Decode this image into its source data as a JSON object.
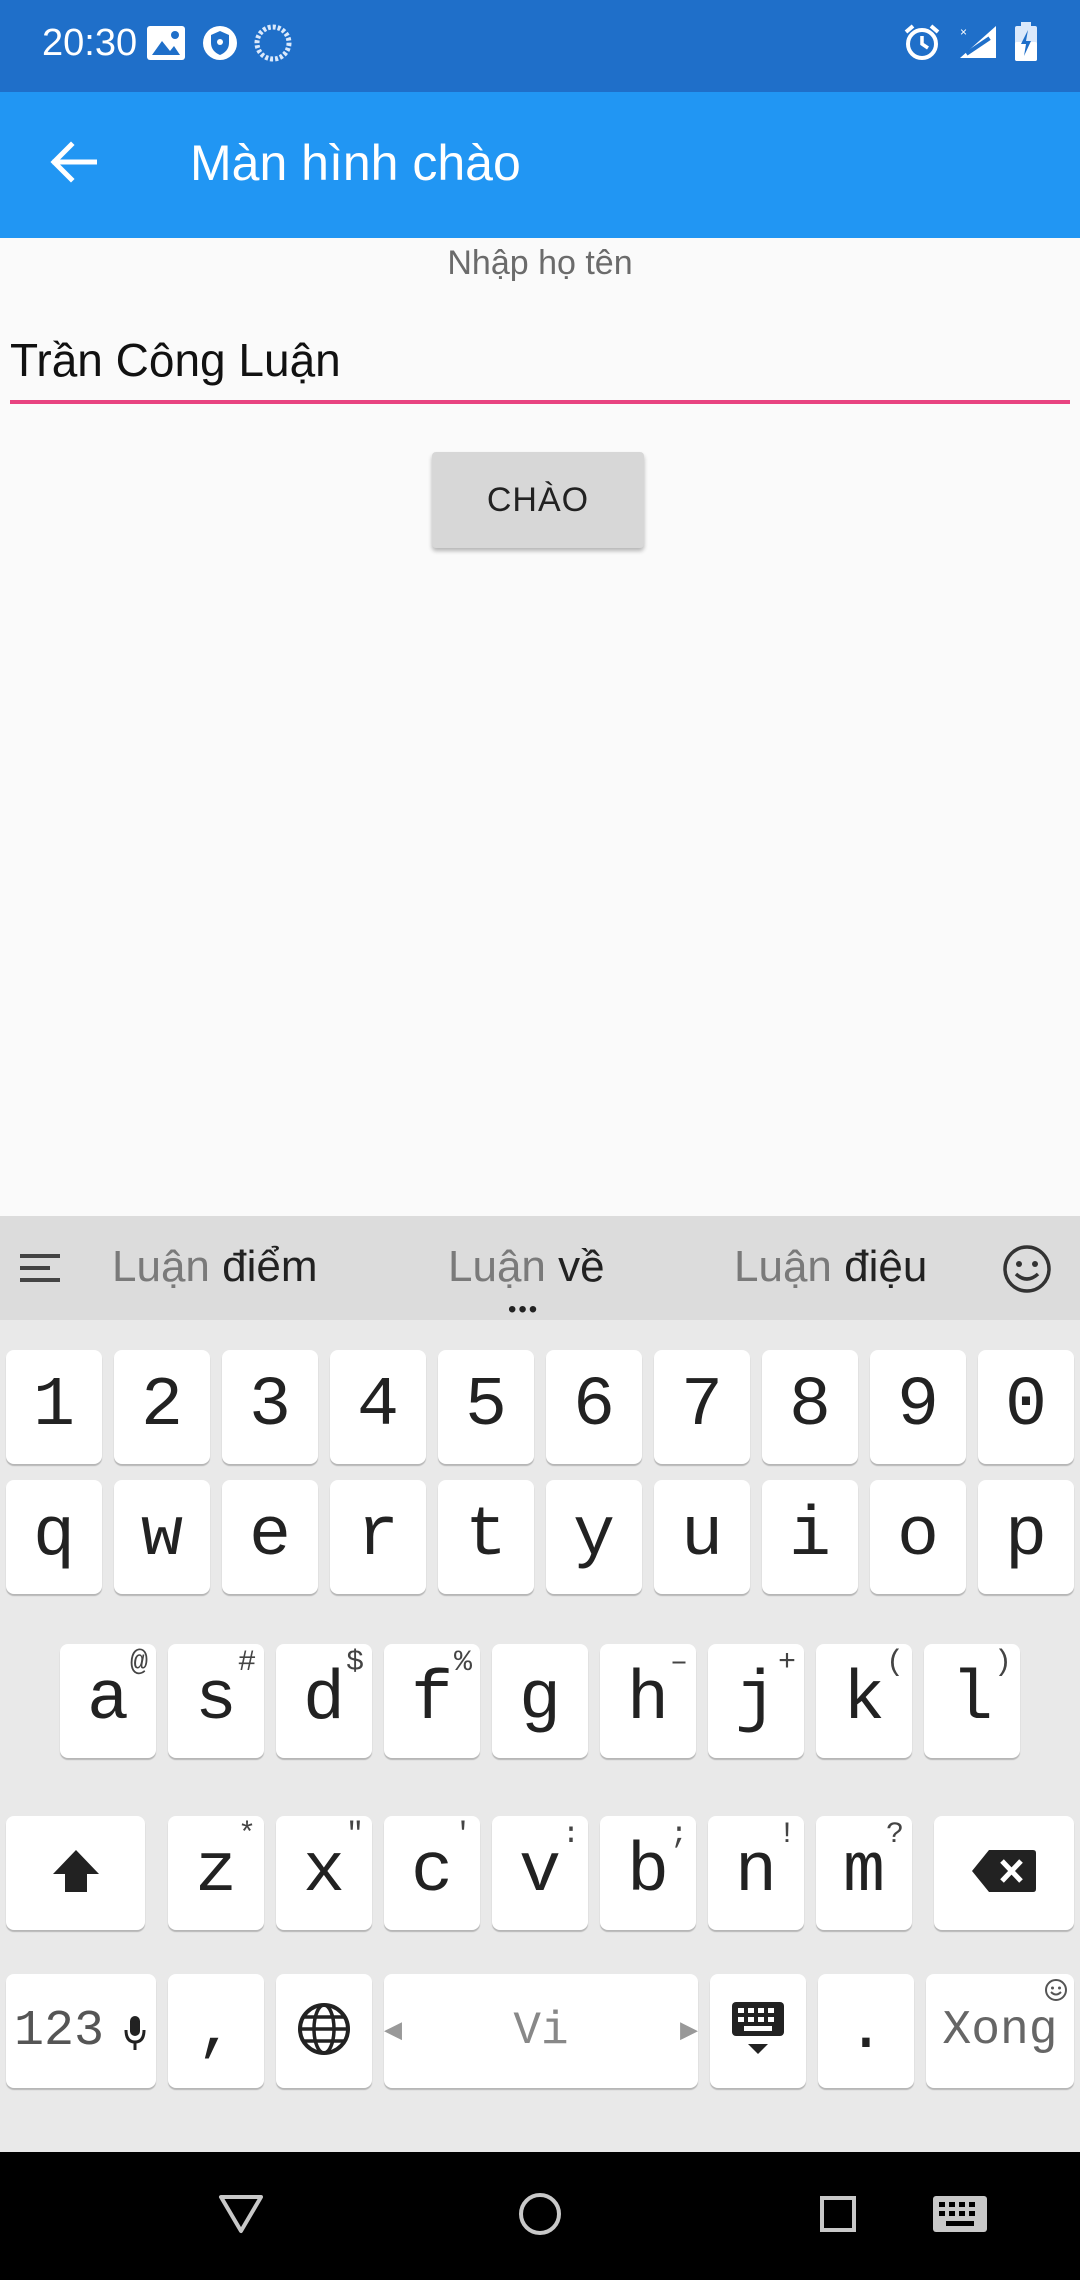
{
  "status_bar": {
    "time": "20:30"
  },
  "app_bar": {
    "title": "Màn hình chào"
  },
  "form": {
    "label": "Nhập họ tên",
    "name_value": "Trần Công Luận",
    "button_label": "CHÀO"
  },
  "keyboard": {
    "suggestions": [
      {
        "prefix": "Luận",
        "word": "điểm"
      },
      {
        "prefix": "Luận",
        "word": "về"
      },
      {
        "prefix": "Luận",
        "word": "điệu"
      }
    ],
    "row_numbers": [
      "1",
      "2",
      "3",
      "4",
      "5",
      "6",
      "7",
      "8",
      "9",
      "0"
    ],
    "row_qwerty": [
      "q",
      "w",
      "e",
      "r",
      "t",
      "y",
      "u",
      "i",
      "o",
      "p"
    ],
    "row_asdf": [
      {
        "key": "a",
        "hint": "@"
      },
      {
        "key": "s",
        "hint": "#"
      },
      {
        "key": "d",
        "hint": "$"
      },
      {
        "key": "f",
        "hint": "%"
      },
      {
        "key": "g",
        "hint": ""
      },
      {
        "key": "h",
        "hint": "–"
      },
      {
        "key": "j",
        "hint": "+"
      },
      {
        "key": "k",
        "hint": "("
      },
      {
        "key": "l",
        "hint": ")"
      }
    ],
    "row_zxcv": [
      {
        "key": "z",
        "hint": "*"
      },
      {
        "key": "x",
        "hint": "\""
      },
      {
        "key": "c",
        "hint": "'"
      },
      {
        "key": "v",
        "hint": ":"
      },
      {
        "key": "b",
        "hint": ";"
      },
      {
        "key": "n",
        "hint": "!"
      },
      {
        "key": "m",
        "hint": "?"
      }
    ],
    "symbols_label": "123",
    "comma_label": ",",
    "space_label": "Vi",
    "period_label": ".",
    "done_label": "Xong"
  },
  "colors": {
    "status_bar": "#1f6fc9",
    "app_bar": "#2196f3",
    "input_underline": "#e84380",
    "button_bg": "#d7d7d7"
  },
  "icons": [
    "image-icon",
    "vpn-shield-icon",
    "sync-icon",
    "alarm-icon",
    "signal-icon",
    "battery-icon",
    "back-arrow-icon",
    "menu-icon",
    "emoji-icon",
    "shift-icon",
    "backspace-icon",
    "mic-icon",
    "globe-icon",
    "keyboard-icon",
    "nav-back-icon",
    "nav-home-icon",
    "nav-recents-icon",
    "nav-keyboard-icon"
  ]
}
